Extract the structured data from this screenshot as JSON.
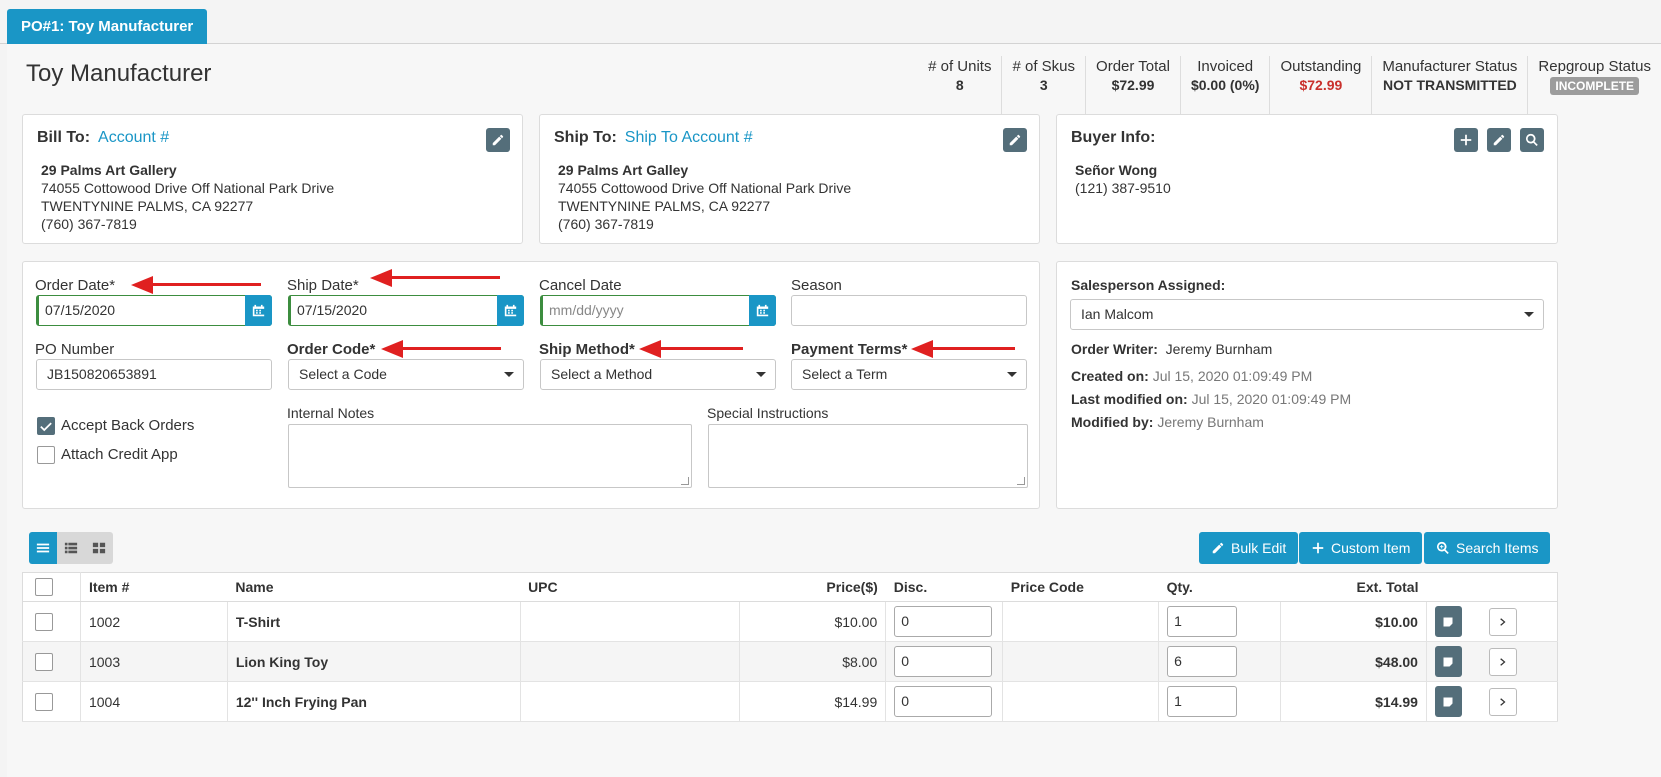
{
  "tab": {
    "label": "PO#1: Toy Manufacturer"
  },
  "page_title": "Toy Manufacturer",
  "stats": [
    {
      "label": "# of Units",
      "value": "8"
    },
    {
      "label": "# of Skus",
      "value": "3"
    },
    {
      "label": "Order Total",
      "value": "$72.99"
    },
    {
      "label": "Invoiced",
      "value": "$0.00 (0%)"
    },
    {
      "label": "Outstanding",
      "value": "$72.99"
    },
    {
      "label": "Manufacturer Status",
      "value": "NOT TRANSMITTED"
    },
    {
      "label": "Repgroup Status",
      "value": "INCOMPLETE"
    }
  ],
  "bill_to": {
    "label": "Bill To:",
    "link": "Account #",
    "name": "29 Palms Art Gallery",
    "address1": "74055 Cottowood Drive Off National Park Drive",
    "address2": "TWENTYNINE PALMS, CA 92277",
    "phone": "(760) 367-7819"
  },
  "ship_to": {
    "label": "Ship To:",
    "link": "Ship To Account #",
    "name": "29 Palms Art Galley",
    "address1": "74055 Cottowood Drive Off National Park Drive",
    "address2": "TWENTYNINE PALMS, CA 92277",
    "phone": "(760) 367-7819"
  },
  "buyer": {
    "label": "Buyer Info:",
    "name": "Señor Wong",
    "phone": "(121) 387-9510"
  },
  "form": {
    "order_date": {
      "label": "Order Date*",
      "value": "07/15/2020"
    },
    "ship_date": {
      "label": "Ship Date*",
      "value": "07/15/2020"
    },
    "cancel_date": {
      "label": "Cancel Date",
      "placeholder": "mm/dd/yyyy"
    },
    "season": {
      "label": "Season",
      "value": ""
    },
    "po_number": {
      "label": "PO Number",
      "value": "JB150820653891"
    },
    "order_code": {
      "label": "Order Code*",
      "value": "Select a Code"
    },
    "ship_method": {
      "label": "Ship Method*",
      "value": "Select a Method"
    },
    "payment_terms": {
      "label": "Payment Terms*",
      "value": "Select a Term"
    },
    "accept_back_orders": {
      "label": "Accept Back Orders",
      "checked": true
    },
    "attach_credit_app": {
      "label": "Attach Credit App",
      "checked": false
    },
    "internal_notes": {
      "label": "Internal Notes"
    },
    "special_instructions": {
      "label": "Special Instructions"
    }
  },
  "sales": {
    "salesperson_label": "Salesperson Assigned:",
    "salesperson_value": "Ian Malcom",
    "order_writer_label": "Order Writer:",
    "order_writer_value": "Jeremy Burnham",
    "created_label": "Created on:",
    "created_value": "Jul 15, 2020 01:09:49 PM",
    "modified_label": "Last modified on:",
    "modified_value": "Jul 15, 2020 01:09:49 PM",
    "modified_by_label": "Modified by:",
    "modified_by_value": "Jeremy Burnham"
  },
  "toolbar": {
    "bulk_edit": "Bulk Edit",
    "custom_item": "Custom Item",
    "search_items": "Search Items"
  },
  "table": {
    "headers": [
      "Item #",
      "Name",
      "UPC",
      "Price($)",
      "Disc.",
      "Price Code",
      "Qty.",
      "Ext. Total"
    ],
    "rows": [
      {
        "item": "1002",
        "name": "T-Shirt",
        "upc": "",
        "price": "$10.00",
        "disc": "0",
        "price_code": "",
        "qty": "1",
        "ext": "$10.00"
      },
      {
        "item": "1003",
        "name": "Lion King Toy",
        "upc": "",
        "price": "$8.00",
        "disc": "0",
        "price_code": "",
        "qty": "6",
        "ext": "$48.00"
      },
      {
        "item": "1004",
        "name": "12'' Inch Frying Pan",
        "upc": "",
        "price": "$14.99",
        "disc": "0",
        "price_code": "",
        "qty": "1",
        "ext": "$14.99"
      }
    ]
  },
  "colors": {
    "accent": "#1a96c6",
    "dark_button": "#546e7a",
    "alert_red": "#c9302c",
    "arrow_red": "#e02020"
  }
}
